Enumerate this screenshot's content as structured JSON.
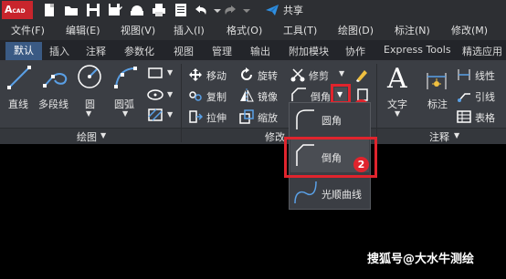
{
  "title_bar": {
    "logo_text": "A",
    "logo_sub": "CAD",
    "share_label": "共享"
  },
  "menu": [
    "文件(F)",
    "编辑(E)",
    "视图(V)",
    "插入(I)",
    "格式(O)",
    "工具(T)",
    "绘图(D)",
    "标注(N)",
    "修改(M)"
  ],
  "tabs": [
    "默认",
    "插入",
    "注释",
    "参数化",
    "视图",
    "管理",
    "输出",
    "附加模块",
    "协作",
    "Express Tools",
    "精选应用"
  ],
  "draw_panel": {
    "tools": [
      "直线",
      "多段线",
      "圆",
      "圆弧"
    ],
    "footer": "绘图"
  },
  "modify_panel": {
    "tools": [
      "移动",
      "旋转",
      "修剪",
      "复制",
      "镜像",
      "倒角",
      "拉伸",
      "缩放"
    ],
    "footer": "修改"
  },
  "annotate_panel": {
    "tools": [
      "文字",
      "标注",
      "线性",
      "引线",
      "表格"
    ],
    "footer": "注释"
  },
  "dropdown": {
    "items": [
      "圆角",
      "倒角",
      "光顺曲线"
    ]
  },
  "badges": [
    "1",
    "2"
  ],
  "watermark": "搜狐号@大水牛测绘",
  "colors": {
    "accent": "#3a5a84",
    "highlight": "#e0242d",
    "logo": "#c8252c"
  }
}
